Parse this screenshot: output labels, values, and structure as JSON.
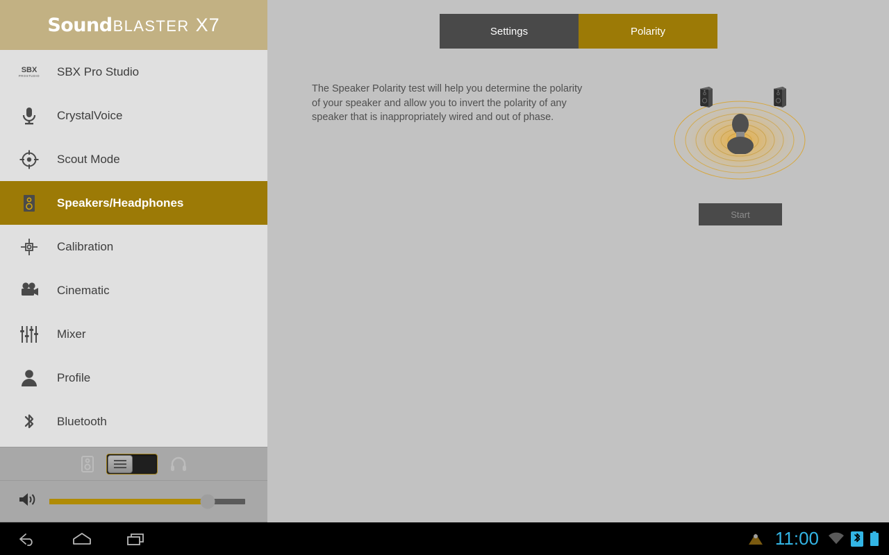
{
  "brand": {
    "sound": "Sound",
    "blaster": "BLASTER",
    "model": "X7"
  },
  "sidebar": {
    "items": [
      {
        "label": "SBX Pro Studio",
        "icon": "sbx-pro-studio-icon",
        "active": false
      },
      {
        "label": "CrystalVoice",
        "icon": "microphone-icon",
        "active": false
      },
      {
        "label": "Scout Mode",
        "icon": "crosshair-icon",
        "active": false
      },
      {
        "label": "Speakers/Headphones",
        "icon": "speaker-icon",
        "active": true
      },
      {
        "label": "Calibration",
        "icon": "calibration-target-icon",
        "active": false
      },
      {
        "label": "Cinematic",
        "icon": "movie-camera-icon",
        "active": false
      },
      {
        "label": "Mixer",
        "icon": "sliders-icon",
        "active": false
      },
      {
        "label": "Profile",
        "icon": "person-icon",
        "active": false
      },
      {
        "label": "Bluetooth",
        "icon": "bluetooth-icon",
        "active": false
      }
    ],
    "output_toggle": {
      "left_icon": "speaker-icon",
      "right_icon": "headphone-icon",
      "knob_icon": "lines-icon",
      "position": "speaker"
    },
    "volume": {
      "icon": "volume-up-icon",
      "percent": 81
    }
  },
  "main": {
    "tabs": [
      {
        "label": "Settings",
        "active": false
      },
      {
        "label": "Polarity",
        "active": true
      }
    ],
    "description": "The Speaker Polarity test will help you determine the polarity of your speaker and allow you to invert the polarity of any speaker that is inappropriately wired and out of phase.",
    "graphic": {
      "person_icon": "person-listener-icon",
      "left_speaker_icon": "speaker-box-icon",
      "right_speaker_icon": "speaker-box-icon",
      "ring_color": "#d9a227"
    },
    "start_button": "Start"
  },
  "system_bar": {
    "back_icon": "back-arrow-icon",
    "home_icon": "home-icon",
    "recents_icon": "recent-apps-icon",
    "warning_icon": "warning-triangle-icon",
    "clock": "11:00",
    "wifi_icon": "wifi-icon",
    "bluetooth_icon": "bluetooth-icon",
    "battery_icon": "battery-full-icon"
  },
  "colors": {
    "brand_header": "#c2b183",
    "accent_gold": "#9c7a06",
    "sidebar_bg": "#e0e0e0",
    "content_bg": "#c2c2c2",
    "clock_blue": "#33b5e5"
  }
}
